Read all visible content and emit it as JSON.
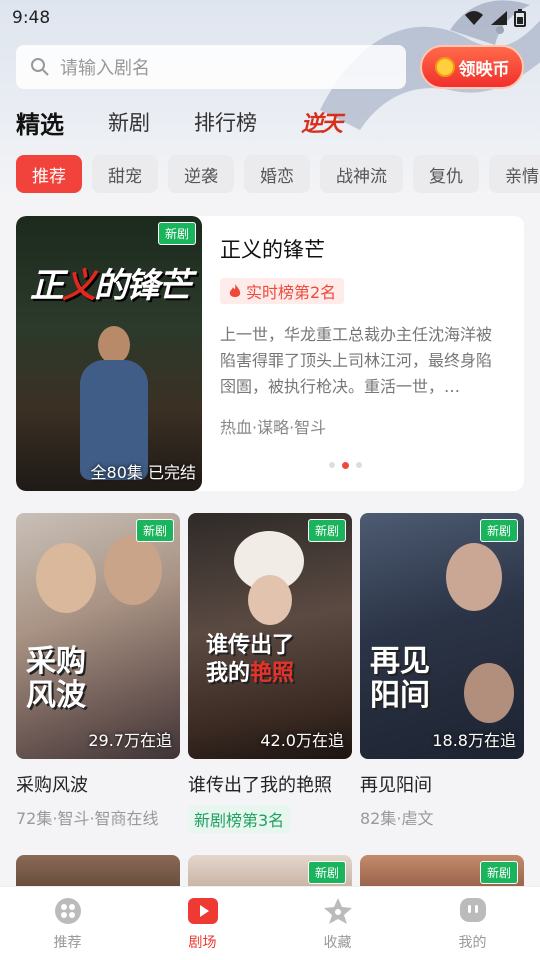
{
  "status_bar": {
    "time": "9:48"
  },
  "search": {
    "placeholder": "请输入剧名",
    "coin_button": "领映币"
  },
  "top_tabs": [
    {
      "label": "精选",
      "active": true
    },
    {
      "label": "新剧"
    },
    {
      "label": "排行榜"
    },
    {
      "label": "逆天"
    }
  ],
  "chips": [
    "推荐",
    "甜宠",
    "逆袭",
    "婚恋",
    "战神流",
    "复仇",
    "亲情"
  ],
  "feature": {
    "badge": "新剧",
    "poster_title_a": "正",
    "poster_title_red": "义",
    "poster_title_b": "的锋芒",
    "episodes": "全80集 已完结",
    "title": "正义的锋芒",
    "rank": "实时榜第2名",
    "description": "上一世，华龙重工总裁办主任沈海洋被陷害得罪了顶头上司林江河，最终身陷囹圄，被执行枪决。重活一世，…",
    "genres": "热血·谋略·智斗"
  },
  "cards": [
    {
      "badge": "新剧",
      "art_line1": "采购",
      "art_line2": "风波",
      "views": "29.7万在追",
      "title": "采购风波",
      "sub": "72集·智斗·智商在线"
    },
    {
      "badge": "新剧",
      "art_line1": "谁传出了",
      "art_line2": "我的",
      "art_red": "艳照",
      "views": "42.0万在追",
      "title": "谁传出了我的艳照",
      "tag": "新剧榜第3名"
    },
    {
      "badge": "新剧",
      "art_line1": "再见",
      "art_line2": "阳间",
      "views": "18.8万在追",
      "title": "再见阳间",
      "sub": "82集·虐文"
    }
  ],
  "row2_badges": [
    "新剧",
    "新剧"
  ],
  "bottom_nav": [
    {
      "label": "推荐",
      "icon": "film-reel-icon"
    },
    {
      "label": "剧场",
      "icon": "play-icon",
      "active": true
    },
    {
      "label": "收藏",
      "icon": "star-icon"
    },
    {
      "label": "我的",
      "icon": "profile-icon"
    }
  ],
  "colors": {
    "accent": "#ee3a32",
    "new_badge": "#19b45c"
  }
}
